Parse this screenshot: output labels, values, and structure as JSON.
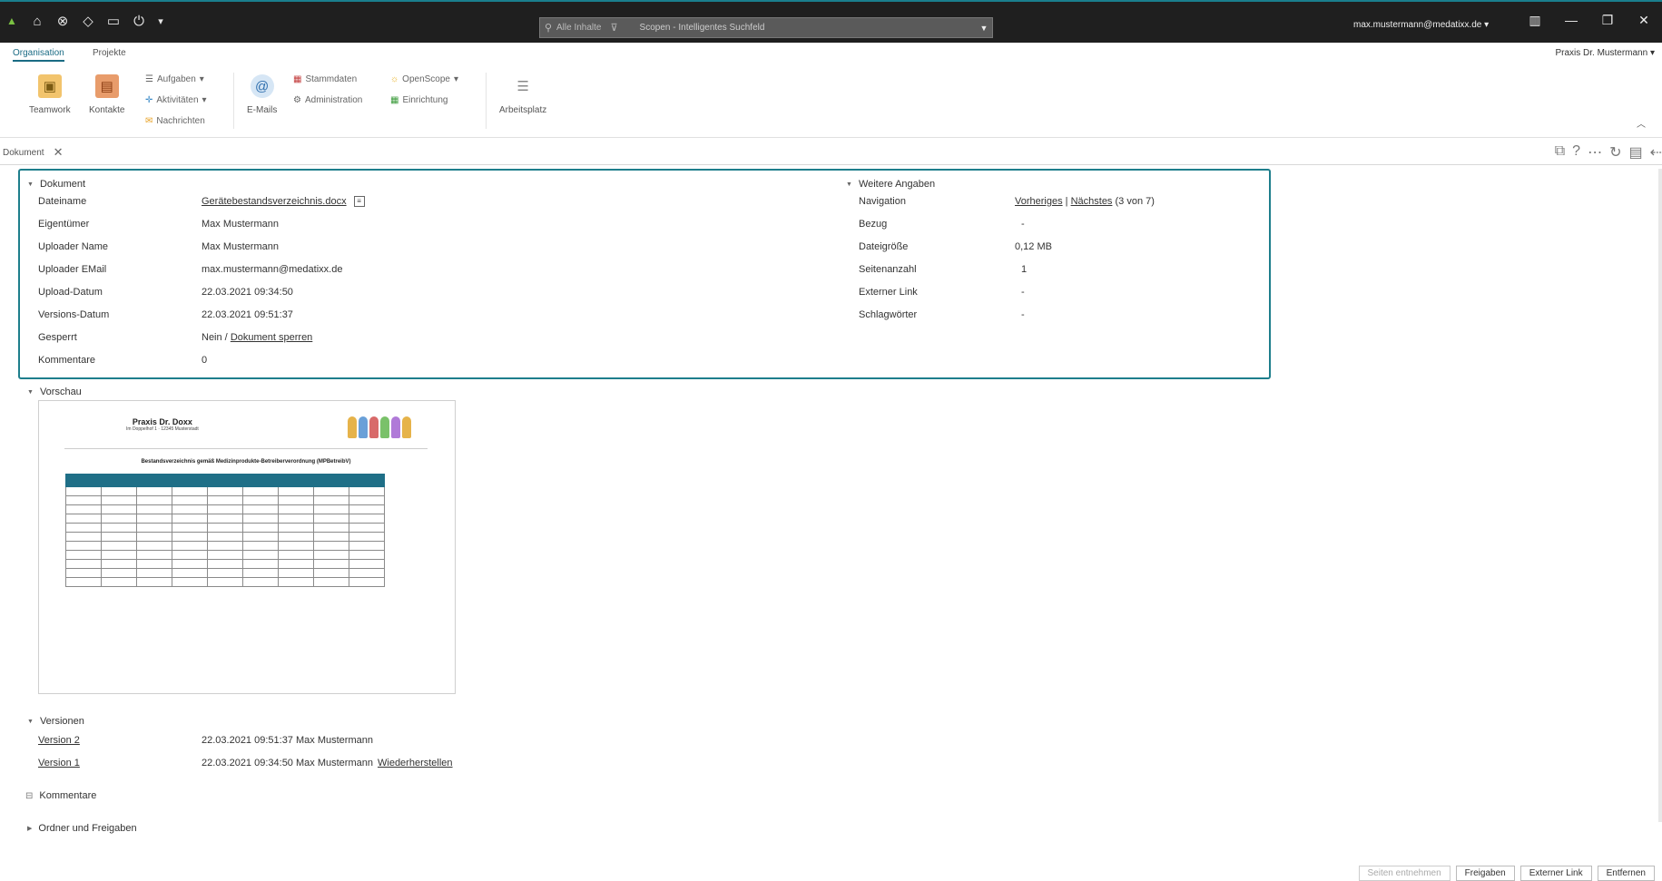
{
  "titlebar": {
    "search_scope": "Alle Inhalte",
    "search_placeholder": "Scopen - Intelligentes Suchfeld",
    "user_email": "max.mustermann@medatixx.de",
    "user_caret": "▾"
  },
  "ribbon": {
    "tabs": [
      "Organisation",
      "Projekte"
    ],
    "practice": "Praxis Dr. Mustermann",
    "teamwork": "Teamwork",
    "kontakte": "Kontakte",
    "aufgaben": "Aufgaben",
    "aktivitaeten": "Aktivitäten",
    "nachrichten": "Nachrichten",
    "emails": "E-Mails",
    "stammdaten": "Stammdaten",
    "administration": "Administration",
    "openscope": "OpenScope",
    "einrichtung": "Einrichtung",
    "arbeitsplatz": "Arbeitsplatz"
  },
  "doc_tab": {
    "label": "Dokument"
  },
  "dokument": {
    "title": "Dokument",
    "fields": [
      {
        "label": "Dateiname",
        "value": "Gerätebestandsverzeichnis.docx"
      },
      {
        "label": "Eigentümer",
        "value": "Max Mustermann"
      },
      {
        "label": "Uploader Name",
        "value": "Max Mustermann"
      },
      {
        "label": "Uploader EMail",
        "value": "max.mustermann@medatixx.de"
      },
      {
        "label": "Upload-Datum",
        "value": "22.03.2021 09:34:50"
      },
      {
        "label": "Versions-Datum",
        "value": "22.03.2021 09:51:37"
      },
      {
        "label": "Gesperrt",
        "value": "Nein /",
        "link": "Dokument sperren"
      },
      {
        "label": "Kommentare",
        "value": "0"
      }
    ]
  },
  "weitere": {
    "title": "Weitere Angaben",
    "fields": [
      {
        "label": "Navigation",
        "prev": "Vorheriges",
        "sep": "|",
        "next": "Nächstes",
        "count": "(3 von 7)"
      },
      {
        "label": "Bezug",
        "value": "-"
      },
      {
        "label": "Dateigröße",
        "value": "0,12 MB"
      },
      {
        "label": "Seitenanzahl",
        "value": "1"
      },
      {
        "label": "Externer Link",
        "value": "-"
      },
      {
        "label": "Schlagwörter",
        "value": "-"
      }
    ]
  },
  "vorschau": {
    "title": "Vorschau",
    "doc_practice": "Praxis Dr. Doxx",
    "doc_address": "Im Doppelhof 1 · 12345 Musterstadt",
    "doc_heading": "Bestandsverzeichnis gemäß Medizinprodukte-Betreiberverordnung (MPBetreibV)"
  },
  "versionen": {
    "title": "Versionen",
    "items": [
      {
        "name": "Version 2",
        "meta": "22.03.2021 09:51:37 Max Mustermann",
        "action": ""
      },
      {
        "name": "Version 1",
        "meta": "22.03.2021 09:34:50 Max Mustermann",
        "action": "Wiederherstellen"
      }
    ]
  },
  "kommentare": {
    "title": "Kommentare"
  },
  "ordner": {
    "title": "Ordner und Freigaben"
  },
  "buttons": {
    "seiten_entfernen": "Seiten entnehmen",
    "freigaben": "Freigaben",
    "externer_link": "Externer Link",
    "entfernen": "Entfernen"
  }
}
